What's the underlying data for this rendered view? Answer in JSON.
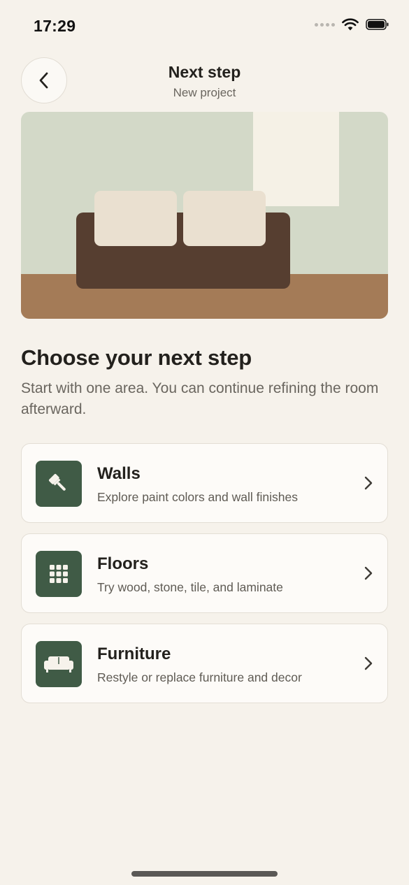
{
  "status_bar": {
    "time": "17:29",
    "icons": [
      "cellular-signal-icon",
      "wifi-icon",
      "battery-icon"
    ]
  },
  "header": {
    "back_icon": "chevron-left-icon",
    "title": "Next step",
    "subtitle": "New project"
  },
  "illustration": {
    "scene": "living-room-sofa",
    "colors": {
      "wall": "#d3d9c8",
      "window": "#f5f1e6",
      "floor": "#a47b57",
      "sofa": "#563e30",
      "cushion": "#eae0d0"
    }
  },
  "section": {
    "title": "Choose your next step",
    "description": "Start with one area. You can continue refining the room afterward."
  },
  "options": [
    {
      "icon": "paint-brush-icon",
      "title": "Walls",
      "description": "Explore paint colors and wall finishes"
    },
    {
      "icon": "tile-grid-icon",
      "title": "Floors",
      "description": "Try wood, stone, tile, and laminate"
    },
    {
      "icon": "sofa-icon",
      "title": "Furniture",
      "description": "Restyle or replace furniture and decor"
    }
  ],
  "colors": {
    "background": "#f6f2eb",
    "accent": "#405b46",
    "card": "#fdfbf8",
    "text_primary": "#23211d",
    "text_secondary": "#6a665f"
  }
}
